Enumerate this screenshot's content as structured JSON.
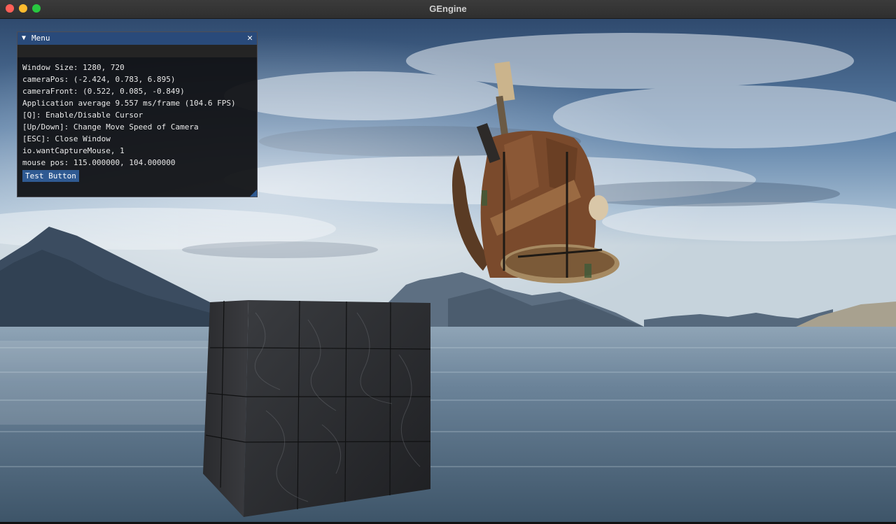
{
  "window": {
    "title": "GEngine"
  },
  "menu": {
    "title": "Menu",
    "lines": [
      "Window Size: 1280, 720",
      "cameraPos: (-2.424, 0.783, 6.895)",
      "cameraFront: (0.522, 0.085, -0.849)",
      "Application average 9.557 ms/frame (104.6 FPS)",
      "[Q]: Enable/Disable Cursor",
      "[Up/Down]: Change Move Speed of Camera",
      "[ESC]: Close Window",
      "io.wantCaptureMouse, 1",
      "mouse pos: 115.000000, 104.000000"
    ],
    "button_label": "Test Button"
  },
  "icons": {
    "collapse": "triangle-down-icon",
    "close": "close-icon"
  },
  "colors": {
    "imgui_title": "#294a7a",
    "imgui_button": "#2f5a92",
    "traffic_close": "#ff5f57",
    "traffic_min": "#febc2e",
    "traffic_max": "#28c840"
  }
}
